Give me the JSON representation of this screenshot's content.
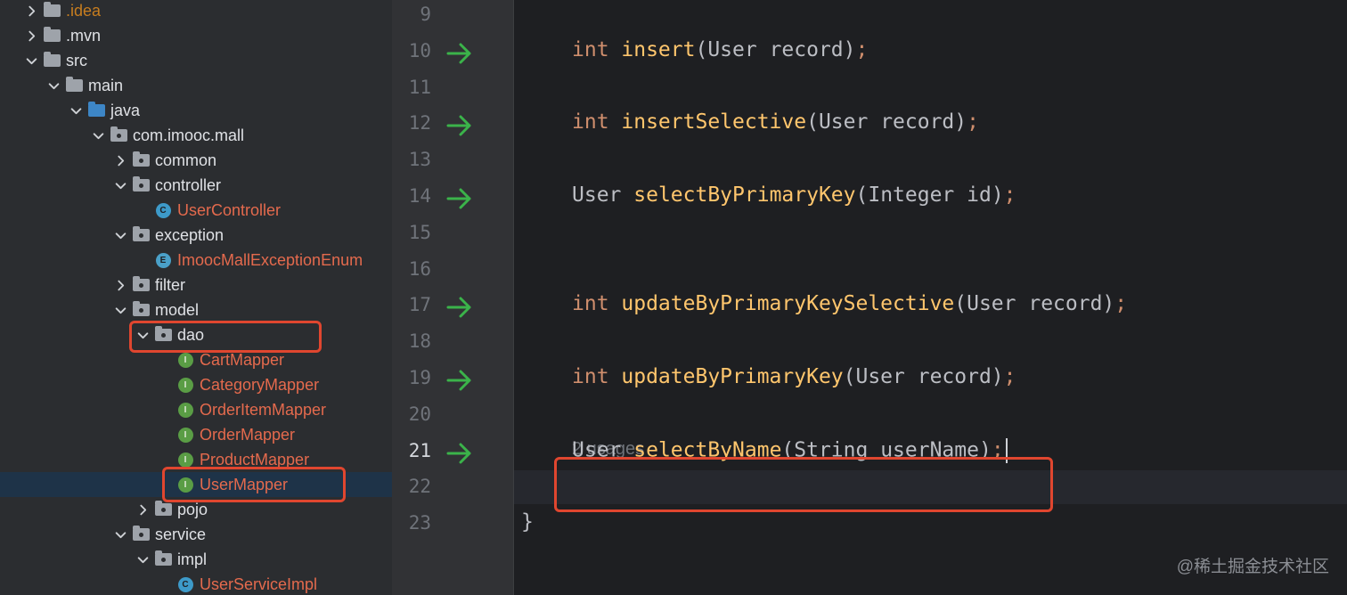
{
  "tree": {
    "items": [
      {
        "label": ".idea",
        "depth": 1,
        "chevron": "right",
        "icon": "folder",
        "color": "dim"
      },
      {
        "label": ".mvn",
        "depth": 1,
        "chevron": "right",
        "icon": "folder",
        "color": "normal"
      },
      {
        "label": "src",
        "depth": 1,
        "chevron": "down",
        "icon": "folder",
        "color": "normal"
      },
      {
        "label": "main",
        "depth": 2,
        "chevron": "down",
        "icon": "folder",
        "color": "normal"
      },
      {
        "label": "java",
        "depth": 3,
        "chevron": "down",
        "icon": "folder-blue",
        "color": "normal"
      },
      {
        "label": "com.imooc.mall",
        "depth": 4,
        "chevron": "down",
        "icon": "package",
        "color": "normal"
      },
      {
        "label": "common",
        "depth": 5,
        "chevron": "right",
        "icon": "package",
        "color": "normal"
      },
      {
        "label": "controller",
        "depth": 5,
        "chevron": "down",
        "icon": "package",
        "color": "normal"
      },
      {
        "label": "UserController",
        "depth": 6,
        "chevron": "none",
        "icon": "class",
        "color": "orange"
      },
      {
        "label": "exception",
        "depth": 5,
        "chevron": "down",
        "icon": "package",
        "color": "normal"
      },
      {
        "label": "ImoocMallExceptionEnum",
        "depth": 6,
        "chevron": "none",
        "icon": "enum",
        "color": "orange"
      },
      {
        "label": "filter",
        "depth": 5,
        "chevron": "right",
        "icon": "package",
        "color": "normal"
      },
      {
        "label": "model",
        "depth": 5,
        "chevron": "down",
        "icon": "package",
        "color": "normal"
      },
      {
        "label": "dao",
        "depth": 6,
        "chevron": "down",
        "icon": "package",
        "color": "normal"
      },
      {
        "label": "CartMapper",
        "depth": 7,
        "chevron": "none",
        "icon": "interface",
        "color": "orange"
      },
      {
        "label": "CategoryMapper",
        "depth": 7,
        "chevron": "none",
        "icon": "interface",
        "color": "orange"
      },
      {
        "label": "OrderItemMapper",
        "depth": 7,
        "chevron": "none",
        "icon": "interface",
        "color": "orange"
      },
      {
        "label": "OrderMapper",
        "depth": 7,
        "chevron": "none",
        "icon": "interface",
        "color": "orange"
      },
      {
        "label": "ProductMapper",
        "depth": 7,
        "chevron": "none",
        "icon": "interface",
        "color": "orange"
      },
      {
        "label": "UserMapper",
        "depth": 7,
        "chevron": "none",
        "icon": "interface",
        "color": "orange",
        "selected": true
      },
      {
        "label": "pojo",
        "depth": 6,
        "chevron": "right",
        "icon": "package",
        "color": "normal"
      },
      {
        "label": "service",
        "depth": 5,
        "chevron": "down",
        "icon": "package",
        "color": "normal"
      },
      {
        "label": "impl",
        "depth": 6,
        "chevron": "down",
        "icon": "package",
        "color": "normal"
      },
      {
        "label": "UserServiceImpl",
        "depth": 7,
        "chevron": "none",
        "icon": "class",
        "color": "orange"
      }
    ]
  },
  "gutter": {
    "line_numbers": [
      "9",
      "10",
      "11",
      "12",
      "13",
      "14",
      "15",
      "16",
      "17",
      "18",
      "19",
      "20",
      "21",
      "22",
      "23"
    ],
    "current_line": "21",
    "arrow_lines": [
      "10",
      "12",
      "14",
      "17",
      "19",
      "21"
    ]
  },
  "editor": {
    "lines": [
      {
        "line": "10",
        "tokens": [
          [
            "kw",
            "int "
          ],
          [
            "fn",
            "insert"
          ],
          [
            "ty",
            "(User record)"
          ],
          [
            "semi",
            ";"
          ]
        ]
      },
      {
        "line": "12",
        "tokens": [
          [
            "kw",
            "int "
          ],
          [
            "fn",
            "insertSelective"
          ],
          [
            "ty",
            "(User record)"
          ],
          [
            "semi",
            ";"
          ]
        ]
      },
      {
        "line": "14",
        "tokens": [
          [
            "ty",
            "User "
          ],
          [
            "fn",
            "selectByPrimaryKey"
          ],
          [
            "ty",
            "(Integer id)"
          ],
          [
            "semi",
            ";"
          ]
        ]
      },
      {
        "line": "17",
        "tokens": [
          [
            "kw",
            "int "
          ],
          [
            "fn",
            "updateByPrimaryKeySelective"
          ],
          [
            "ty",
            "(User record)"
          ],
          [
            "semi",
            ";"
          ]
        ]
      },
      {
        "line": "19",
        "tokens": [
          [
            "kw",
            "int "
          ],
          [
            "fn",
            "updateByPrimaryKey"
          ],
          [
            "ty",
            "(User record)"
          ],
          [
            "semi",
            ";"
          ]
        ]
      },
      {
        "line": "21",
        "tokens": [
          [
            "ty",
            "User "
          ],
          [
            "fn",
            "selectByName"
          ],
          [
            "ty",
            "(String userName)"
          ],
          [
            "semi",
            ";"
          ]
        ]
      },
      {
        "line": "23",
        "tokens": [
          [
            "ty",
            "}"
          ]
        ]
      }
    ],
    "usages_hint": "2 usages"
  },
  "watermark": "@稀土掘金技术社区",
  "colors": {
    "tree_bg": "#2b2d30",
    "editor_bg": "#1e1f22",
    "keyword": "#cf8e6d",
    "method": "#ffc66d",
    "highlight_box": "#e0462f",
    "gutter_arrow": "#3bb34a"
  }
}
